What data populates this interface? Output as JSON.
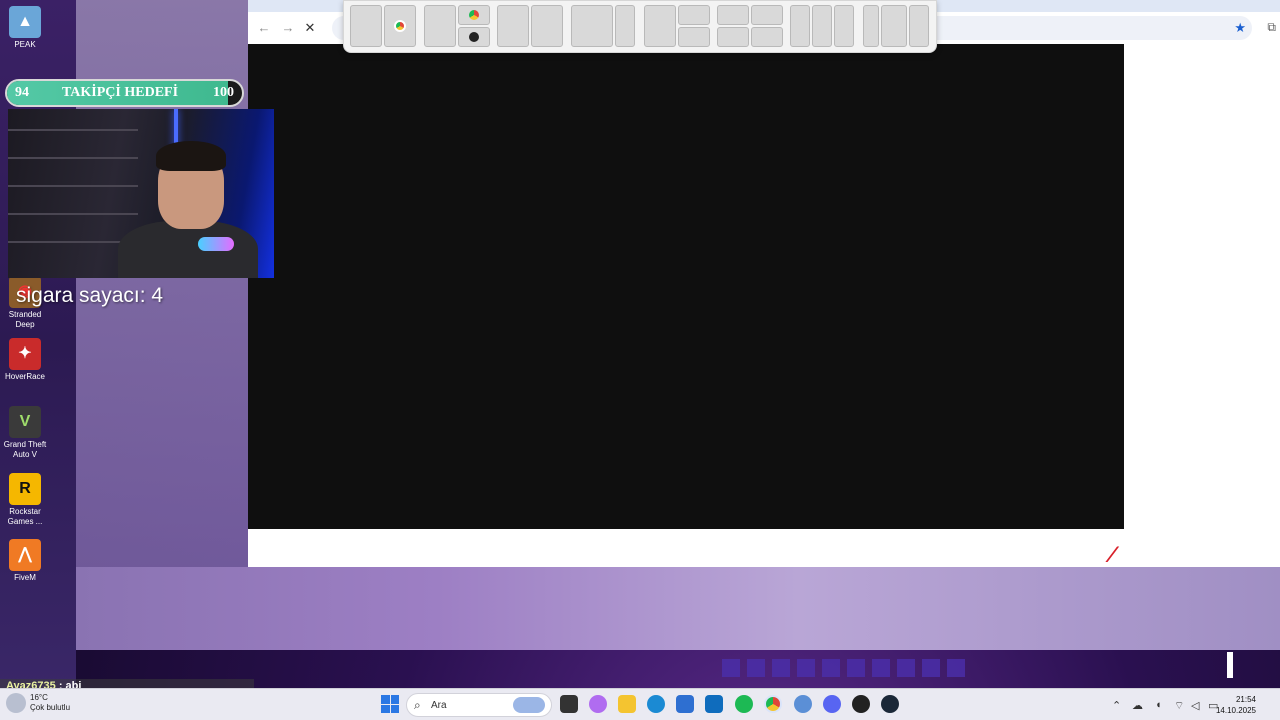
{
  "desktop_icons": [
    {
      "label": "PEAK",
      "color": "#6aa6d8",
      "glyph": "▲"
    },
    {
      "label": "Stranded Deep",
      "color": "#8a5b2a",
      "glyph": "◉"
    },
    {
      "label": "HoverRace",
      "color": "#c92b2b",
      "glyph": "✦"
    },
    {
      "label": "Grand Theft Auto V",
      "color": "#3a3a3a",
      "glyph": "V"
    },
    {
      "label": "Rockstar Games ...",
      "color": "#f5b700",
      "glyph": "R"
    },
    {
      "label": "FiveM",
      "color": "#f07a24",
      "glyph": "⋀"
    }
  ],
  "goal_bar": {
    "current": "94",
    "label": "TAKİPÇİ HEDEFİ",
    "target": "100",
    "progress": 0.94
  },
  "counter": "sigara sayacı: 4",
  "chat": {
    "user": "Ayaz6735",
    "message": ": abi"
  },
  "browser": {
    "back_icon": "←",
    "forward_icon": "→",
    "stop_icon": "✕",
    "bookmark_icon": "★"
  },
  "taskbar": {
    "search_placeholder": "Ara",
    "weather_temp": "16°C",
    "weather_desc": "Çok bulutlu",
    "time": "21:54",
    "date": "14.10.2025",
    "apps": [
      {
        "name": "start-icon",
        "color": "#2b78e4"
      },
      {
        "name": "search-widget-icon",
        "color": "#9bb6e6"
      },
      {
        "name": "task-view-icon",
        "color": "#333333"
      },
      {
        "name": "copilot-icon",
        "color": "#b06cf0"
      },
      {
        "name": "file-explorer-icon",
        "color": "#f4c430"
      },
      {
        "name": "edge-icon",
        "color": "#1b8ad3"
      },
      {
        "name": "store-icon",
        "color": "#2e6fd1"
      },
      {
        "name": "outlook-icon",
        "color": "#0f6cbd"
      },
      {
        "name": "spotify-icon",
        "color": "#1db954"
      },
      {
        "name": "chrome-icon",
        "color": "#e0463a"
      },
      {
        "name": "settings-icon",
        "color": "#5b8fd6"
      },
      {
        "name": "discord-icon",
        "color": "#5865f2"
      },
      {
        "name": "obs-icon",
        "color": "#222222"
      },
      {
        "name": "steam-icon",
        "color": "#1b2838"
      }
    ]
  }
}
